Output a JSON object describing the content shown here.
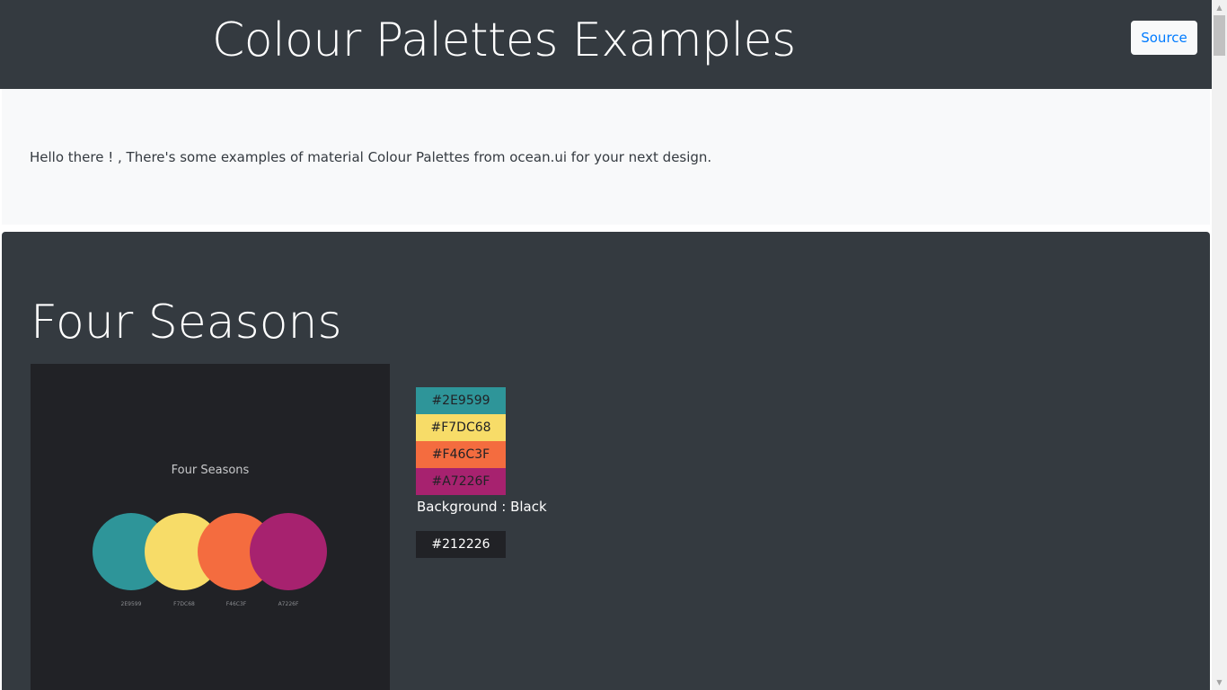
{
  "header": {
    "title": "Colour Palettes Examples",
    "source_label": "Source"
  },
  "intro": {
    "text": "Hello there ! , There's some examples of material Colour Palettes from ocean.ui for your next design."
  },
  "palette": {
    "title": "Four Seasons",
    "preview": {
      "title": "Four Seasons",
      "circles": [
        {
          "label": "2E9599",
          "color": "#2E9599"
        },
        {
          "label": "F7DC68",
          "color": "#F7DC68"
        },
        {
          "label": "F46C3F",
          "color": "#F46C3F"
        },
        {
          "label": "A7226F",
          "color": "#A7226F"
        }
      ]
    },
    "swatches": [
      {
        "label": "#2E9599",
        "color": "#2E9599"
      },
      {
        "label": "#F7DC68",
        "color": "#F7DC68"
      },
      {
        "label": "#F46C3F",
        "color": "#F46C3F"
      },
      {
        "label": "#A7226F",
        "color": "#A7226F"
      }
    ],
    "background_label": "Background : Black",
    "background_swatch": {
      "label": "#212226",
      "color": "#212226"
    }
  },
  "icons": {
    "scroll_up": "scroll-up-arrow-icon",
    "scroll_down": "scroll-down-arrow-icon"
  }
}
